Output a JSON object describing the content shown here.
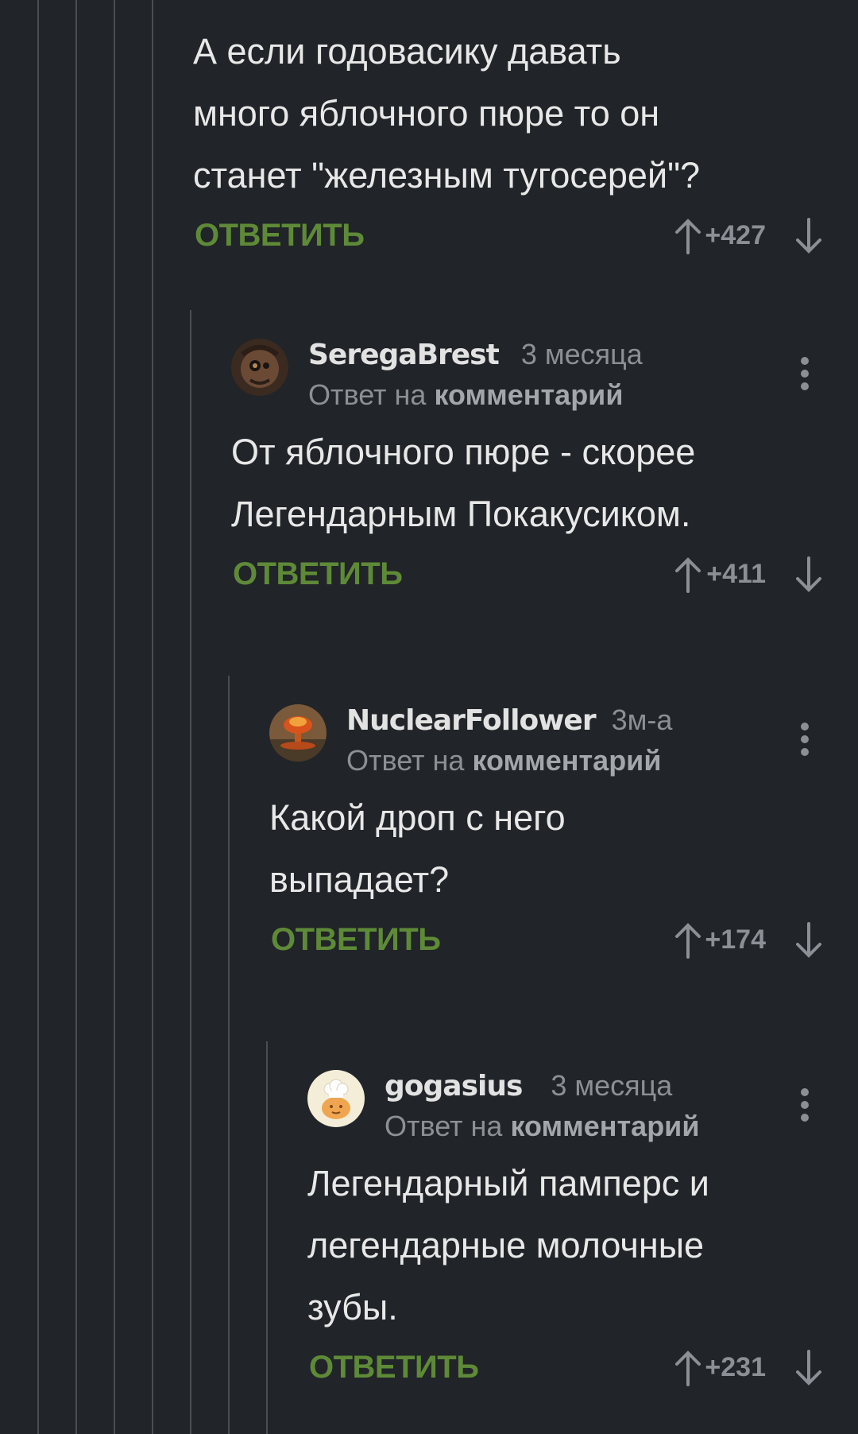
{
  "reply_label": "ОТВЕТИТЬ",
  "colors": {
    "background": "#212428",
    "reply_green": "#5e8a38",
    "muted": "#8c9096"
  },
  "top_comment": {
    "text": "А если годовасику давать\nмного яблочного пюре то он\nстанет \"железным тугосерей\"?",
    "rating": "+427"
  },
  "comments": [
    {
      "author": "SeregaBrest",
      "time": "3 месяца",
      "reply_to_prefix": "Ответ на",
      "reply_to_link": "комментарий",
      "text": "От яблочного пюре - скорее\nЛегендарным Покакусиком.",
      "rating": "+411",
      "avatar_icon": "user-avatar-steampunk-icon"
    },
    {
      "author": "NuclearFollower",
      "time": "3м-а",
      "reply_to_prefix": "Ответ на",
      "reply_to_link": "комментарий",
      "text": "Какой дроп с него\nвыпадает?",
      "rating": "+174",
      "avatar_icon": "user-avatar-mushroom-cloud-icon"
    },
    {
      "author": "gogasius",
      "time": "3 месяца",
      "reply_to_prefix": "Ответ на",
      "reply_to_link": "комментарий",
      "text": "Легендарный памперс и\nлегендарные молочные\nзубы.",
      "rating": "+231",
      "avatar_icon": "user-avatar-chef-icon"
    }
  ]
}
